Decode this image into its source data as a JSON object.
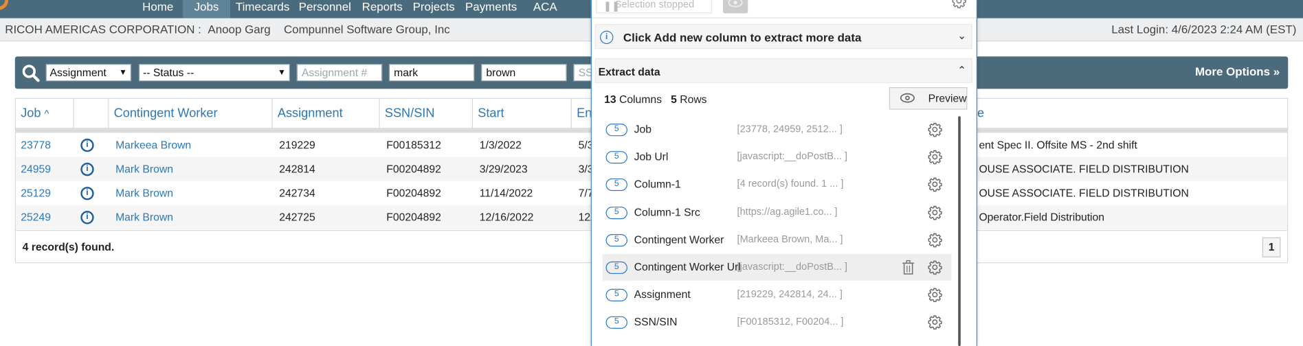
{
  "nav": {
    "items": [
      "Home",
      "Jobs",
      "Timecards",
      "Personnel",
      "Reports",
      "Projects",
      "Payments",
      "ACA"
    ],
    "active": "Jobs"
  },
  "subheader": {
    "org": "RICOH AMERICAS CORPORATION :",
    "user": "Anoop Garg",
    "company": "Compunnel Software Group, Inc",
    "last_login": "Last Login: 4/6/2023 2:24 AM (EST)"
  },
  "search": {
    "type_select": "Assignment",
    "status_select": "-- Status --",
    "assignment_placeholder": "Assignment #",
    "first_name": "mark",
    "last_name": "brown",
    "ssn_placeholder": "SS",
    "more_options": "More Options »"
  },
  "table": {
    "headers": [
      "Job",
      "",
      "Contingent Worker",
      "Assignment",
      "SSN/SIN",
      "Start",
      "En",
      "e"
    ],
    "sort_indicator": "^",
    "rows": [
      {
        "job": "23778",
        "worker": "Markeea Brown",
        "assignment": "219229",
        "ssn": "F00185312",
        "start": "1/3/2022",
        "end": "5/3",
        "title": "ent Spec II. Offsite MS - 2nd shift"
      },
      {
        "job": "24959",
        "worker": "Mark Brown",
        "assignment": "242814",
        "ssn": "F00204892",
        "start": "3/29/2023",
        "end": "3/3",
        "title": "OUSE ASSOCIATE. FIELD DISTRIBUTION"
      },
      {
        "job": "25129",
        "worker": "Mark Brown",
        "assignment": "242734",
        "ssn": "F00204892",
        "start": "11/14/2022",
        "end": "7/7",
        "title": "OUSE ASSOCIATE. FIELD DISTRIBUTION"
      },
      {
        "job": "25249",
        "worker": "Mark Brown",
        "assignment": "242725",
        "ssn": "F00204892",
        "start": "12/16/2022",
        "end": "12/",
        "title": "Operator.Field Distribution"
      }
    ],
    "record_count": "4 record(s) found.",
    "page": "1"
  },
  "panel": {
    "status": "Selection stopped",
    "notice": "Click Add new column to extract more data",
    "extract_title": "Extract data",
    "columns_count": "13",
    "columns_label": "Columns",
    "rows_count": "5",
    "rows_label": "Rows",
    "preview_label": "Preview",
    "fields": [
      {
        "count": "5",
        "name": "Job",
        "value": "[23778, 24959, 2512... ]"
      },
      {
        "count": "5",
        "name": "Job Url",
        "value": "[javascript:__doPostB... ]"
      },
      {
        "count": "5",
        "name": "Column-1",
        "value": "[4 record(s) found. 1 ... ]"
      },
      {
        "count": "5",
        "name": "Column-1 Src",
        "value": "[https://ag.agile1.co... ]"
      },
      {
        "count": "5",
        "name": "Contingent Worker",
        "value": "[Markeea Brown, Ma... ]"
      },
      {
        "count": "5",
        "name": "Contingent Worker Url",
        "value": "[javascript:__doPostB... ]"
      },
      {
        "count": "5",
        "name": "Assignment",
        "value": "[219229, 242814, 24... ]"
      },
      {
        "count": "5",
        "name": "SSN/SIN",
        "value": "[F00185312, F00204... ]"
      }
    ]
  }
}
